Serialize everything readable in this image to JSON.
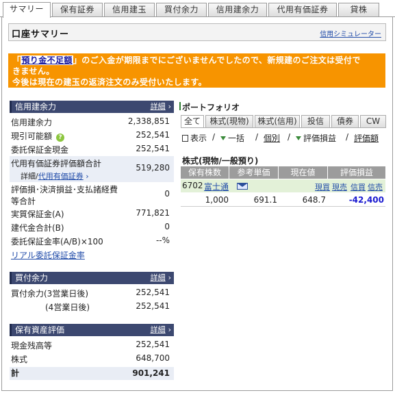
{
  "tabs": [
    "サマリー",
    "保有証券",
    "信用建玉",
    "買付余力",
    "信用建余力",
    "代用有価証券",
    "貸株"
  ],
  "header": {
    "title": "口座サマリー",
    "simulator_link": "信用シミュレーター"
  },
  "warning": {
    "prefix": "「",
    "link": "預り金不足額",
    "line1_rest": "」のご入金が期限までにございませんでしたので、新規建のご注文は受付で",
    "line2": "きません。",
    "line3": "今後は現在の建玉の返済注文のみ受付いたします。"
  },
  "credit": {
    "title": "信用建余力",
    "detail": "詳細",
    "rows": [
      {
        "label": "信用建余力",
        "value": "2,338,851"
      },
      {
        "label": "現引可能額",
        "value": "252,541"
      },
      {
        "label": "委託保証金現金",
        "value": "252,541"
      },
      {
        "label": "代用有価証券評価額合計",
        "value": "519,280"
      },
      {
        "label": "評価損･決済損益･支払諸経費",
        "value": "0"
      },
      {
        "label": "等合計",
        "value": ""
      },
      {
        "label": "実質保証金(A)",
        "value": "771,821"
      },
      {
        "label": "建代金合計(B)",
        "value": "0"
      },
      {
        "label": "委託保証金率(A/B)×100",
        "value": "--%"
      }
    ],
    "sub_detail_label": "詳細/",
    "sub_detail_link": "代用有価証券",
    "realtime_link": "リアル委託保証金率"
  },
  "buying": {
    "title": "買付余力",
    "detail": "詳細",
    "rows": [
      {
        "label": "買付余力(3営業日後)",
        "value": "252,541"
      },
      {
        "label": "(4営業日後)",
        "value": "252,541"
      }
    ]
  },
  "assets": {
    "title": "保有資産評価",
    "detail": "詳細",
    "rows": [
      {
        "label": "現金残高等",
        "value": "252,541"
      },
      {
        "label": "株式",
        "value": "648,700"
      },
      {
        "label": "計",
        "value": "901,241"
      }
    ]
  },
  "portfolio": {
    "title": "ポートフォリオ",
    "tabs": [
      "全て",
      "株式(現物)",
      "株式(信用)",
      "投信",
      "債券",
      "CW"
    ],
    "controls": {
      "display": "表示",
      "grouping": "一括",
      "individual": "個別",
      "pl": "評価損益",
      "amount": "評価額"
    },
    "section": "株式(現物/一般預り)",
    "headers": [
      "保有株数",
      "参考単価",
      "現在値",
      "評価損益"
    ],
    "row": {
      "code": "6702",
      "name": "富士通",
      "actions": [
        "現買",
        "現売",
        "信買",
        "信売"
      ],
      "shares": "1,000",
      "ref_price": "691.1",
      "current": "648.7",
      "pl": "-42,400"
    }
  },
  "colors": {
    "warning_bg": "#f79400",
    "panel_head": "#3c4870",
    "link": "#1f4aa8",
    "loss": "#1a1ad0",
    "row_green": "#e3f1d8"
  }
}
